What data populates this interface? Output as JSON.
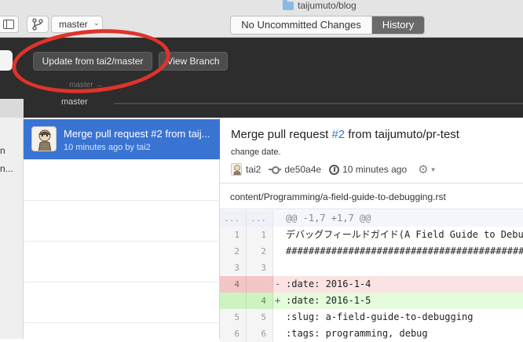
{
  "toolbar": {
    "branch_button_label": "master",
    "window_title": "taijumuto/blog",
    "segments": {
      "uncommitted": "No Uncommitted Changes",
      "history": "History"
    }
  },
  "sync": {
    "update_button": "Update from tai2/master",
    "view_branch_button": "View Branch",
    "branch_label": "master",
    "ghost_label": "master →"
  },
  "left_sidebar_fragments": [
    "n",
    "n..."
  ],
  "commit_list": {
    "items": [
      {
        "title": "Merge pull request #2 from taij...",
        "meta": "10 minutes ago by tai2"
      }
    ]
  },
  "detail": {
    "title_prefix": "Merge pull request ",
    "pr_number": "#2",
    "title_suffix": " from taijumuto/pr-test",
    "description": "change date.",
    "author": "tai2",
    "sha": "de50a4e",
    "time": "10 minutes ago",
    "file_path": "content/Programming/a-field-guide-to-debugging.rst"
  },
  "diff": {
    "lines": [
      {
        "type": "hunk",
        "old": "...",
        "new": "...",
        "sign": "",
        "text": "@@ -1,7 +1,7 @@"
      },
      {
        "type": "ctx",
        "old": "1",
        "new": "1",
        "sign": "",
        "text": "デバッグフィールドガイド(A Field Guide to Debugg"
      },
      {
        "type": "ctx",
        "old": "2",
        "new": "2",
        "sign": "",
        "text": "################################################"
      },
      {
        "type": "ctx",
        "old": "3",
        "new": "3",
        "sign": "",
        "text": ""
      },
      {
        "type": "del",
        "old": "4",
        "new": "",
        "sign": "-",
        "text": ":date: 2016-1-4"
      },
      {
        "type": "add",
        "old": "",
        "new": "4",
        "sign": "+",
        "text": ":date: 2016-1-5"
      },
      {
        "type": "ctx",
        "old": "5",
        "new": "5",
        "sign": "",
        "text": ":slug: a-field-guide-to-debugging"
      },
      {
        "type": "ctx",
        "old": "6",
        "new": "6",
        "sign": "",
        "text": ":tags: programming, debug"
      }
    ]
  },
  "colors": {
    "accent": "#3a74d3",
    "annotation": "#e0332b",
    "deleted": "#fbe3e3",
    "added": "#e4fbdc"
  }
}
